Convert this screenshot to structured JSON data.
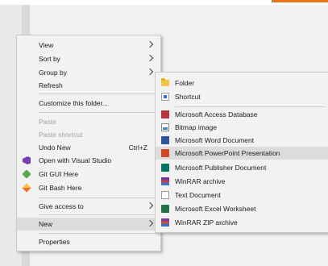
{
  "context_menu": {
    "items": [
      {
        "label": "View"
      },
      {
        "label": "Sort by"
      },
      {
        "label": "Group by"
      },
      {
        "label": "Refresh"
      },
      {
        "label": "Customize this folder..."
      },
      {
        "label": "Paste"
      },
      {
        "label": "Paste shortcut"
      },
      {
        "label": "Undo New",
        "shortcut": "Ctrl+Z"
      },
      {
        "label": "Open with Visual Studio"
      },
      {
        "label": "Git GUI Here"
      },
      {
        "label": "Git Bash Here"
      },
      {
        "label": "Give access to"
      },
      {
        "label": "New"
      },
      {
        "label": "Properties"
      }
    ]
  },
  "new_submenu": {
    "items": [
      {
        "label": "Folder",
        "icon": "folder-icon"
      },
      {
        "label": "Shortcut",
        "icon": "shortcut-icon"
      },
      {
        "label": "Microsoft Access Database",
        "icon": "access-icon"
      },
      {
        "label": "Bitmap image",
        "icon": "bitmap-icon"
      },
      {
        "label": "Microsoft Word Document",
        "icon": "word-icon"
      },
      {
        "label": "Microsoft PowerPoint Presentation",
        "icon": "powerpoint-icon"
      },
      {
        "label": "Microsoft Publisher Document",
        "icon": "publisher-icon"
      },
      {
        "label": "WinRAR archive",
        "icon": "winrar-icon"
      },
      {
        "label": "Text Document",
        "icon": "text-document-icon"
      },
      {
        "label": "Microsoft Excel Worksheet",
        "icon": "excel-icon"
      },
      {
        "label": "WinRAR ZIP archive",
        "icon": "winrar-zip-icon"
      }
    ]
  },
  "colors": {
    "menu_background": "#f2f2f2",
    "hover_background": "#dcdcdc",
    "disabled_text": "#a3a3a3",
    "accent": "#e9731a"
  }
}
